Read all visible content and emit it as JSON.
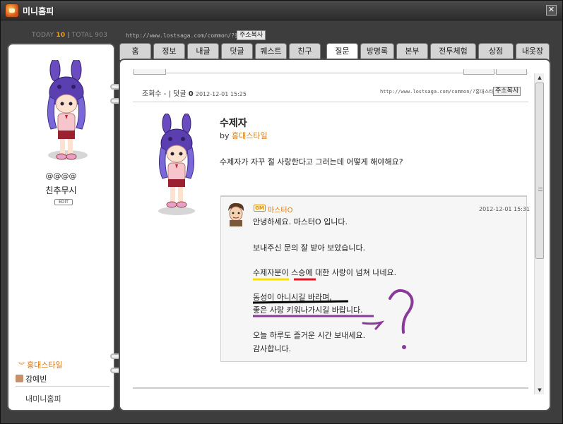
{
  "window": {
    "title": "미니홈피",
    "close_glyph": "✕"
  },
  "counter": {
    "today_label": "TODAY",
    "today_value": "10",
    "sep": " | ",
    "total_label": "TOTAL",
    "total_value": "903"
  },
  "topbar": {
    "url": "http://www.lostsaga.com/common/?홍대스타일",
    "copy_label": "주소복사"
  },
  "profile": {
    "tag": "@@@@",
    "name": "친추무시",
    "edit_label": "EDIT"
  },
  "sidebar": {
    "style_link": "홍대스타일",
    "friend_name": "강예빈",
    "my_home_label": "내미니홈피"
  },
  "tabs": [
    {
      "label": "홈",
      "active": false
    },
    {
      "label": "정보",
      "active": false
    },
    {
      "label": "내글",
      "active": false
    },
    {
      "label": "덧글",
      "active": false
    },
    {
      "label": "퀘스트",
      "active": false
    },
    {
      "label": "친구",
      "active": false
    },
    {
      "label": "질문",
      "active": true
    },
    {
      "label": "방명록",
      "active": false
    },
    {
      "label": "본부",
      "active": false
    },
    {
      "label": "전투체험",
      "active": false
    },
    {
      "label": "상점",
      "active": false
    },
    {
      "label": "내옷장",
      "active": false
    }
  ],
  "post": {
    "views_label": "조회수 - | 덧글",
    "comment_count": "0",
    "date": "2012-12-01 15:25",
    "url": "http://www.lostsaga.com/common/?홍대스타일",
    "copy_label": "주소복사",
    "title": "수제자",
    "by_label": "by",
    "author": "홍대스타일",
    "body": "수제자가 자꾸 절 사랑한다고 그러는데 어떻게 해야해요?"
  },
  "answer": {
    "badge": "GM",
    "name": "마스터O",
    "date": "2012-12-01 15:31",
    "lines": [
      "안녕하세요. 마스터O 입니다.",
      "보내주신 문의 잘 받아 보았습니다.",
      "수제자분이 스승에 대한 사랑이 넘쳐 나네요.",
      "동성이 아니시길 바라며,",
      "좋은 사랑 키워나가시길 바랍니다.",
      "오늘 하루도 즐거운 시간 보내세요.",
      "감사합니다."
    ]
  },
  "scrollbar": {
    "up_glyph": "▲",
    "down_glyph": "▼"
  },
  "colors": {
    "accent_orange": "#e07a10",
    "underline_yellow": "#f5e000",
    "underline_red": "#e8141e",
    "underline_black": "#000000",
    "underline_purple": "#8a3a9a"
  }
}
